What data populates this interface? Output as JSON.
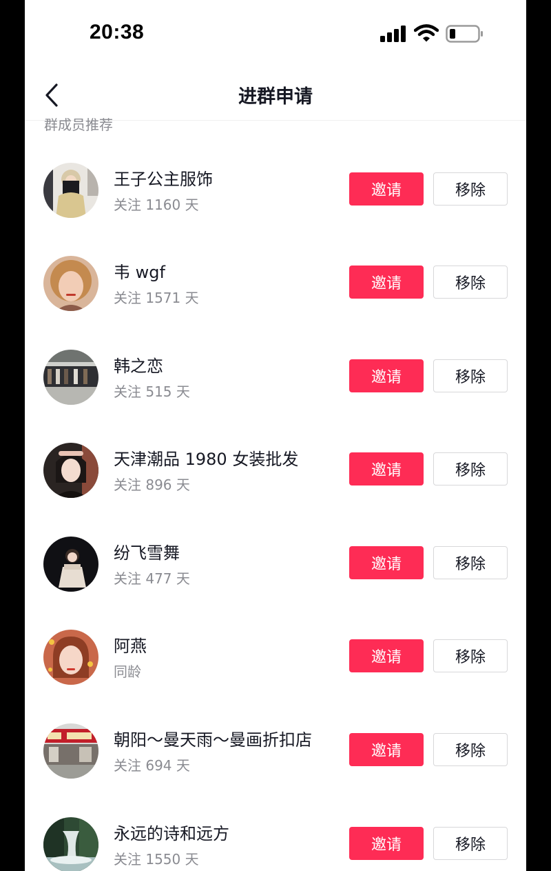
{
  "status_bar": {
    "time": "20:38",
    "icons": [
      "cellular-signal-icon",
      "wifi-icon",
      "battery-icon"
    ]
  },
  "nav": {
    "back_icon": "chevron-left-icon",
    "title": "进群申请"
  },
  "section": {
    "label": "群成员推荐"
  },
  "buttons": {
    "invite_label": "邀请",
    "remove_label": "移除"
  },
  "colors": {
    "accent": "#fe2c55",
    "text_primary": "#161823",
    "text_secondary": "#8a8b91"
  },
  "members": [
    {
      "name": "王子公主服饰",
      "sub": "关注 1160 天"
    },
    {
      "name": "韦 wgf",
      "sub": "关注 1571 天"
    },
    {
      "name": "韩之恋",
      "sub": "关注 515 天"
    },
    {
      "name": "天津潮品 1980 女装批发",
      "sub": "关注 896 天"
    },
    {
      "name": "纷飞雪舞",
      "sub": "关注 477 天"
    },
    {
      "name": "阿燕",
      "sub": "同龄"
    },
    {
      "name": "朝阳～曼天雨～曼画折扣店",
      "sub": "关注 694 天"
    },
    {
      "name": "永远的诗和远方",
      "sub": "关注 1550 天"
    }
  ]
}
